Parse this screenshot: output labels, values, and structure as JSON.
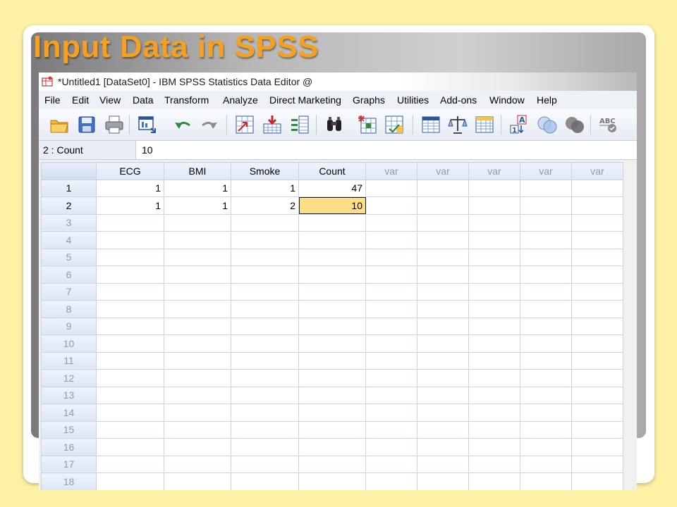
{
  "slide": {
    "title": "Input Data in SPSS",
    "colors": {
      "background": "#fdf1a6",
      "title": "#f5a020",
      "card": "#ffffff"
    }
  },
  "window": {
    "title": "*Untitled1 [DataSet0] - IBM SPSS Statistics Data Editor @",
    "app_icon": "spss-data-editor-icon"
  },
  "menu": [
    {
      "label": "File"
    },
    {
      "label": "Edit"
    },
    {
      "label": "View"
    },
    {
      "label": "Data"
    },
    {
      "label": "Transform"
    },
    {
      "label": "Analyze"
    },
    {
      "label": "Direct Marketing"
    },
    {
      "label": "Graphs"
    },
    {
      "label": "Utilities"
    },
    {
      "label": "Add-ons"
    },
    {
      "label": "Window"
    },
    {
      "label": "Help"
    }
  ],
  "toolbar": {
    "icons": [
      "open-folder-icon",
      "save-icon",
      "print-icon",
      "recall-dialog-icon",
      "undo-icon",
      "redo-icon",
      "goto-case-icon",
      "goto-variable-icon",
      "variables-icon",
      "find-icon",
      "insert-cases-icon",
      "insert-variable-icon",
      "split-file-icon",
      "weight-cases-icon",
      "select-cases-icon",
      "value-labels-icon",
      "use-sets-icon",
      "show-all-variables-icon",
      "spell-check-icon"
    ]
  },
  "cellbar": {
    "reference": "2 : Count",
    "value": "10"
  },
  "grid": {
    "columns": [
      "ECG",
      "BMI",
      "Smoke",
      "Count",
      "var",
      "var",
      "var",
      "var",
      "var"
    ],
    "rows": [
      {
        "num": "1",
        "cells": [
          "1",
          "1",
          "1",
          "47",
          "",
          "",
          "",
          "",
          ""
        ]
      },
      {
        "num": "2",
        "cells": [
          "1",
          "1",
          "2",
          "10",
          "",
          "",
          "",
          "",
          ""
        ]
      },
      {
        "num": "3",
        "cells": [
          "",
          "",
          "",
          "",
          "",
          "",
          "",
          "",
          ""
        ]
      },
      {
        "num": "4",
        "cells": [
          "",
          "",
          "",
          "",
          "",
          "",
          "",
          "",
          ""
        ]
      },
      {
        "num": "5",
        "cells": [
          "",
          "",
          "",
          "",
          "",
          "",
          "",
          "",
          ""
        ]
      },
      {
        "num": "6",
        "cells": [
          "",
          "",
          "",
          "",
          "",
          "",
          "",
          "",
          ""
        ]
      },
      {
        "num": "7",
        "cells": [
          "",
          "",
          "",
          "",
          "",
          "",
          "",
          "",
          ""
        ]
      },
      {
        "num": "8",
        "cells": [
          "",
          "",
          "",
          "",
          "",
          "",
          "",
          "",
          ""
        ]
      },
      {
        "num": "9",
        "cells": [
          "",
          "",
          "",
          "",
          "",
          "",
          "",
          "",
          ""
        ]
      },
      {
        "num": "10",
        "cells": [
          "",
          "",
          "",
          "",
          "",
          "",
          "",
          "",
          ""
        ]
      },
      {
        "num": "11",
        "cells": [
          "",
          "",
          "",
          "",
          "",
          "",
          "",
          "",
          ""
        ]
      },
      {
        "num": "12",
        "cells": [
          "",
          "",
          "",
          "",
          "",
          "",
          "",
          "",
          ""
        ]
      },
      {
        "num": "13",
        "cells": [
          "",
          "",
          "",
          "",
          "",
          "",
          "",
          "",
          ""
        ]
      },
      {
        "num": "14",
        "cells": [
          "",
          "",
          "",
          "",
          "",
          "",
          "",
          "",
          ""
        ]
      },
      {
        "num": "15",
        "cells": [
          "",
          "",
          "",
          "",
          "",
          "",
          "",
          "",
          ""
        ]
      },
      {
        "num": "16",
        "cells": [
          "",
          "",
          "",
          "",
          "",
          "",
          "",
          "",
          ""
        ]
      },
      {
        "num": "17",
        "cells": [
          "",
          "",
          "",
          "",
          "",
          "",
          "",
          "",
          ""
        ]
      },
      {
        "num": "18",
        "cells": [
          "",
          "",
          "",
          "",
          "",
          "",
          "",
          "",
          ""
        ]
      }
    ],
    "used_rows": 2,
    "selected": {
      "row": 1,
      "col": 3
    },
    "colors": {
      "selected": "#fcde86",
      "header": "#dfe8f5",
      "border": "#c8d3e4"
    }
  }
}
